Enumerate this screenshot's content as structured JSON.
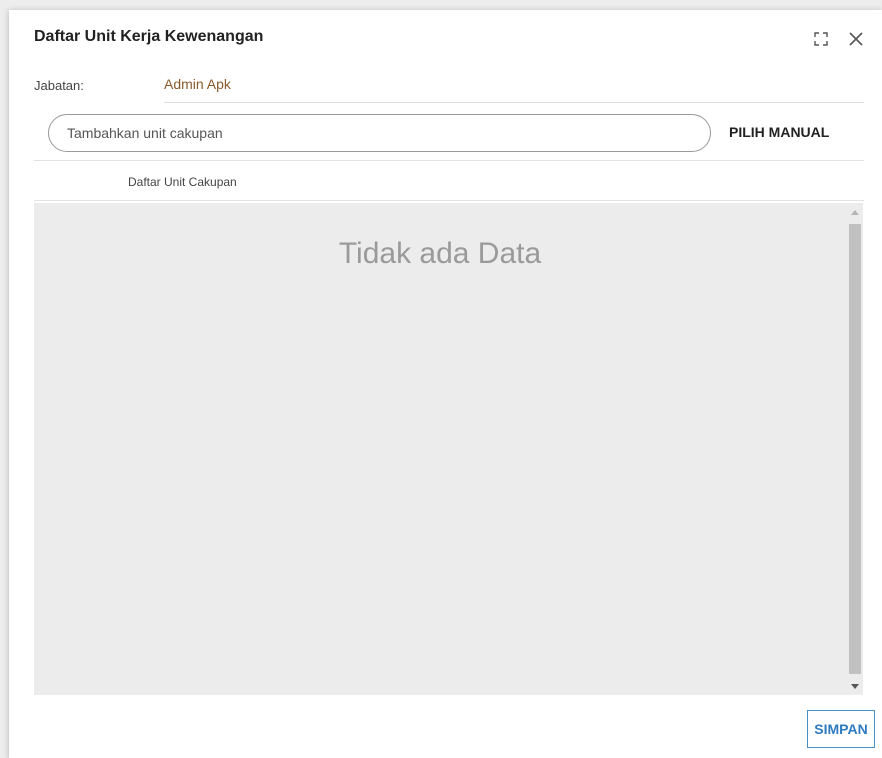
{
  "dialog": {
    "title": "Daftar Unit Kerja Kewenangan",
    "expand_icon": "expand-icon",
    "close_icon": "close-icon"
  },
  "jabatan": {
    "label": "Jabatan:",
    "value": "Admin Apk",
    "value_color": "#8a5a2b"
  },
  "search": {
    "placeholder": "Tambahkan unit cakupan",
    "value": ""
  },
  "pilih_manual_label": "PILIH MANUAL",
  "list": {
    "header": "Daftar Unit Cakupan",
    "empty_text": "Tidak ada Data"
  },
  "footer": {
    "save_label": "SIMPAN",
    "save_color": "#2f7bc0"
  }
}
